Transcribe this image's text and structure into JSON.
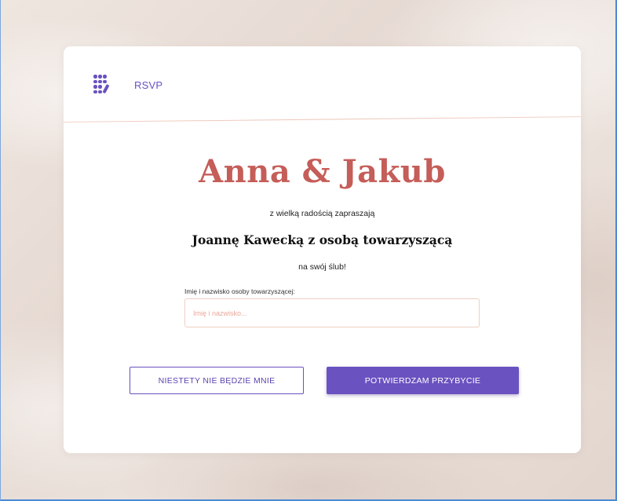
{
  "header": {
    "logo_icon": "dots-logo-icon",
    "nav_link": "RSVP"
  },
  "invitation": {
    "couple": "Anna & Jakub",
    "intro": "z wielką radością zapraszają",
    "guest": "Joannę Kawecką z osobą towarzyszącą",
    "occasion": "na swój ślub!"
  },
  "form": {
    "companion_label": "Imię i nazwisko osoby towarzyszącej:",
    "companion_value": "",
    "companion_placeholder": "Imię i nazwisko..."
  },
  "actions": {
    "decline_label": "NIESTETY NIE BĘDZIE MNIE",
    "confirm_label": "POTWIERDZAM PRZYBYCIE"
  },
  "colors": {
    "accent": "#6a52c0",
    "couple_name": "#c55d58",
    "input_border": "#f0cfc3",
    "placeholder": "#eaa79b"
  }
}
